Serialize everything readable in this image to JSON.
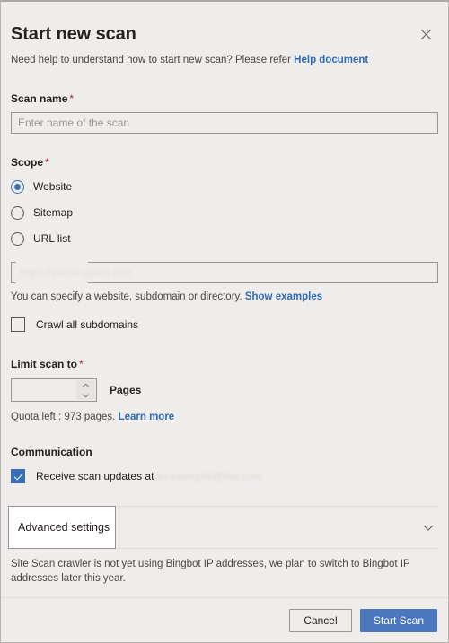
{
  "dialog": {
    "title": "Start new scan",
    "subtitle_text": "Need help to understand how to start new scan? Please refer",
    "help_link_label": "Help document",
    "close_icon": "close-icon"
  },
  "scan_name": {
    "label": "Scan name",
    "required_marker": "*",
    "placeholder": "Enter name of the scan",
    "value": ""
  },
  "scope": {
    "label": "Scope",
    "required_marker": "*",
    "options": [
      {
        "label": "Website",
        "selected": true
      },
      {
        "label": "Sitemap",
        "selected": false
      },
      {
        "label": "URL list",
        "selected": false
      }
    ],
    "url_input": {
      "placeholder_redacted": "https://portal.quilos.pro/",
      "value": ""
    },
    "help_text": "You can specify a website, subdomain or directory.",
    "examples_link_label": "Show examples",
    "crawl_subdomains": {
      "label": "Crawl all subdomains",
      "checked": false
    }
  },
  "limit_scan": {
    "label": "Limit scan to",
    "required_marker": "*",
    "value": "",
    "unit_label": "Pages",
    "spinner_up_icon": "chevron-up-icon",
    "spinner_down_icon": "chevron-down-icon",
    "quota_text": "Quota left : 973 pages.",
    "quota_link_label": "Learn more"
  },
  "communication": {
    "label": "Communication",
    "receive_updates": {
      "label": "Receive scan updates at",
      "email_redacted": "an.example@live.com",
      "checked": true
    }
  },
  "advanced": {
    "label": "Advanced settings",
    "expand_icon": "chevron-down-icon",
    "footnote": "Site Scan crawler is not yet using Bingbot IP addresses, we plan to switch to Bingbot IP addresses later this year."
  },
  "footer": {
    "cancel_label": "Cancel",
    "submit_label": "Start Scan"
  },
  "colors": {
    "background": "#efedec",
    "accent_blue": "#3a6fb5",
    "primary_button": "#4a77bd",
    "link": "#2f6ab5",
    "required_red": "#a4262c",
    "text": "#26201f"
  }
}
